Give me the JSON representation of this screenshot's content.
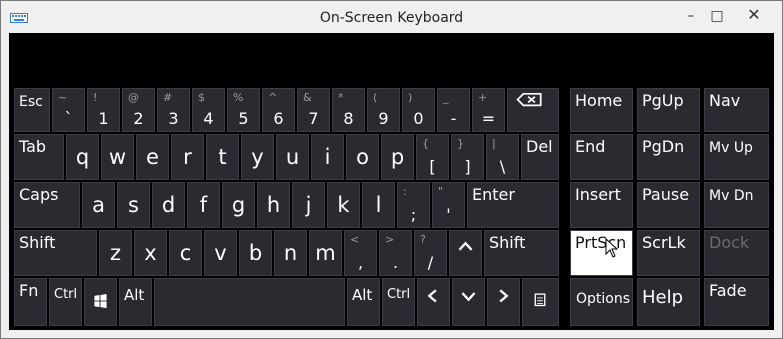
{
  "window": {
    "title": "On-Screen Keyboard",
    "minimize_glyph": "–",
    "maximize_glyph": "□",
    "close_glyph": "✕"
  },
  "keys": {
    "esc": "Esc",
    "tab": "Tab",
    "caps": "Caps",
    "shift_left": "Shift",
    "fn": "Fn",
    "ctrl_left": "Ctrl",
    "alt_left": "Alt",
    "alt_right": "Alt",
    "ctrl_right": "Ctrl",
    "enter": "Enter",
    "shift_right": "Shift",
    "del": "Del",
    "q": "q",
    "w": "w",
    "e": "e",
    "r": "r",
    "t": "t",
    "y": "y",
    "u": "u",
    "i": "i",
    "o": "o",
    "p": "p",
    "a": "a",
    "s": "s",
    "d": "d",
    "f": "f",
    "g": "g",
    "h": "h",
    "j": "j",
    "k": "k",
    "l": "l",
    "z": "z",
    "x": "x",
    "c": "c",
    "v": "v",
    "b": "b",
    "n": "n",
    "m": "m",
    "home": "Home",
    "pgup": "PgUp",
    "nav": "Nav",
    "end": "End",
    "pgdn": "PgDn",
    "mvup": "Mv Up",
    "insert": "Insert",
    "pause": "Pause",
    "mvdn": "Mv Dn",
    "prtscn": "PrtScn",
    "scrlk": "ScrLk",
    "dock": "Dock",
    "options": "Options",
    "help": "Help",
    "fade": "Fade"
  },
  "number_row": [
    {
      "sec": "~",
      "pri": "`"
    },
    {
      "sec": "!",
      "pri": "1"
    },
    {
      "sec": "@",
      "pri": "2"
    },
    {
      "sec": "#",
      "pri": "3"
    },
    {
      "sec": "$",
      "pri": "4"
    },
    {
      "sec": "%",
      "pri": "5"
    },
    {
      "sec": "^",
      "pri": "6"
    },
    {
      "sec": "&",
      "pri": "7"
    },
    {
      "sec": "*",
      "pri": "8"
    },
    {
      "sec": "(",
      "pri": "9"
    },
    {
      "sec": ")",
      "pri": "0"
    },
    {
      "sec": "_",
      "pri": "-"
    },
    {
      "sec": "+",
      "pri": "="
    }
  ],
  "punct": {
    "lbrace": {
      "sec": "{",
      "pri": "["
    },
    "rbrace": {
      "sec": "}",
      "pri": "]"
    },
    "pipe": {
      "sec": "|",
      "pri": "\\"
    },
    "colon": {
      "sec": ":",
      "pri": ";"
    },
    "quote": {
      "sec": "\"",
      "pri": "'"
    },
    "lt": {
      "sec": "<",
      "pri": ","
    },
    "gt": {
      "sec": ">",
      "pri": "."
    },
    "qm": {
      "sec": "?",
      "pri": "/"
    }
  },
  "colors": {
    "key_bg": "#2c2a31",
    "keyboard_bg": "#000000",
    "highlight": "#ffffff",
    "disabled_text": "#6b6b6b"
  },
  "icons": [
    "keyboard-icon",
    "backspace-icon",
    "windows-icon",
    "arrow-up-icon",
    "arrow-left-icon",
    "arrow-down-icon",
    "arrow-right-icon",
    "menu-icon",
    "mouse-cursor-icon"
  ]
}
